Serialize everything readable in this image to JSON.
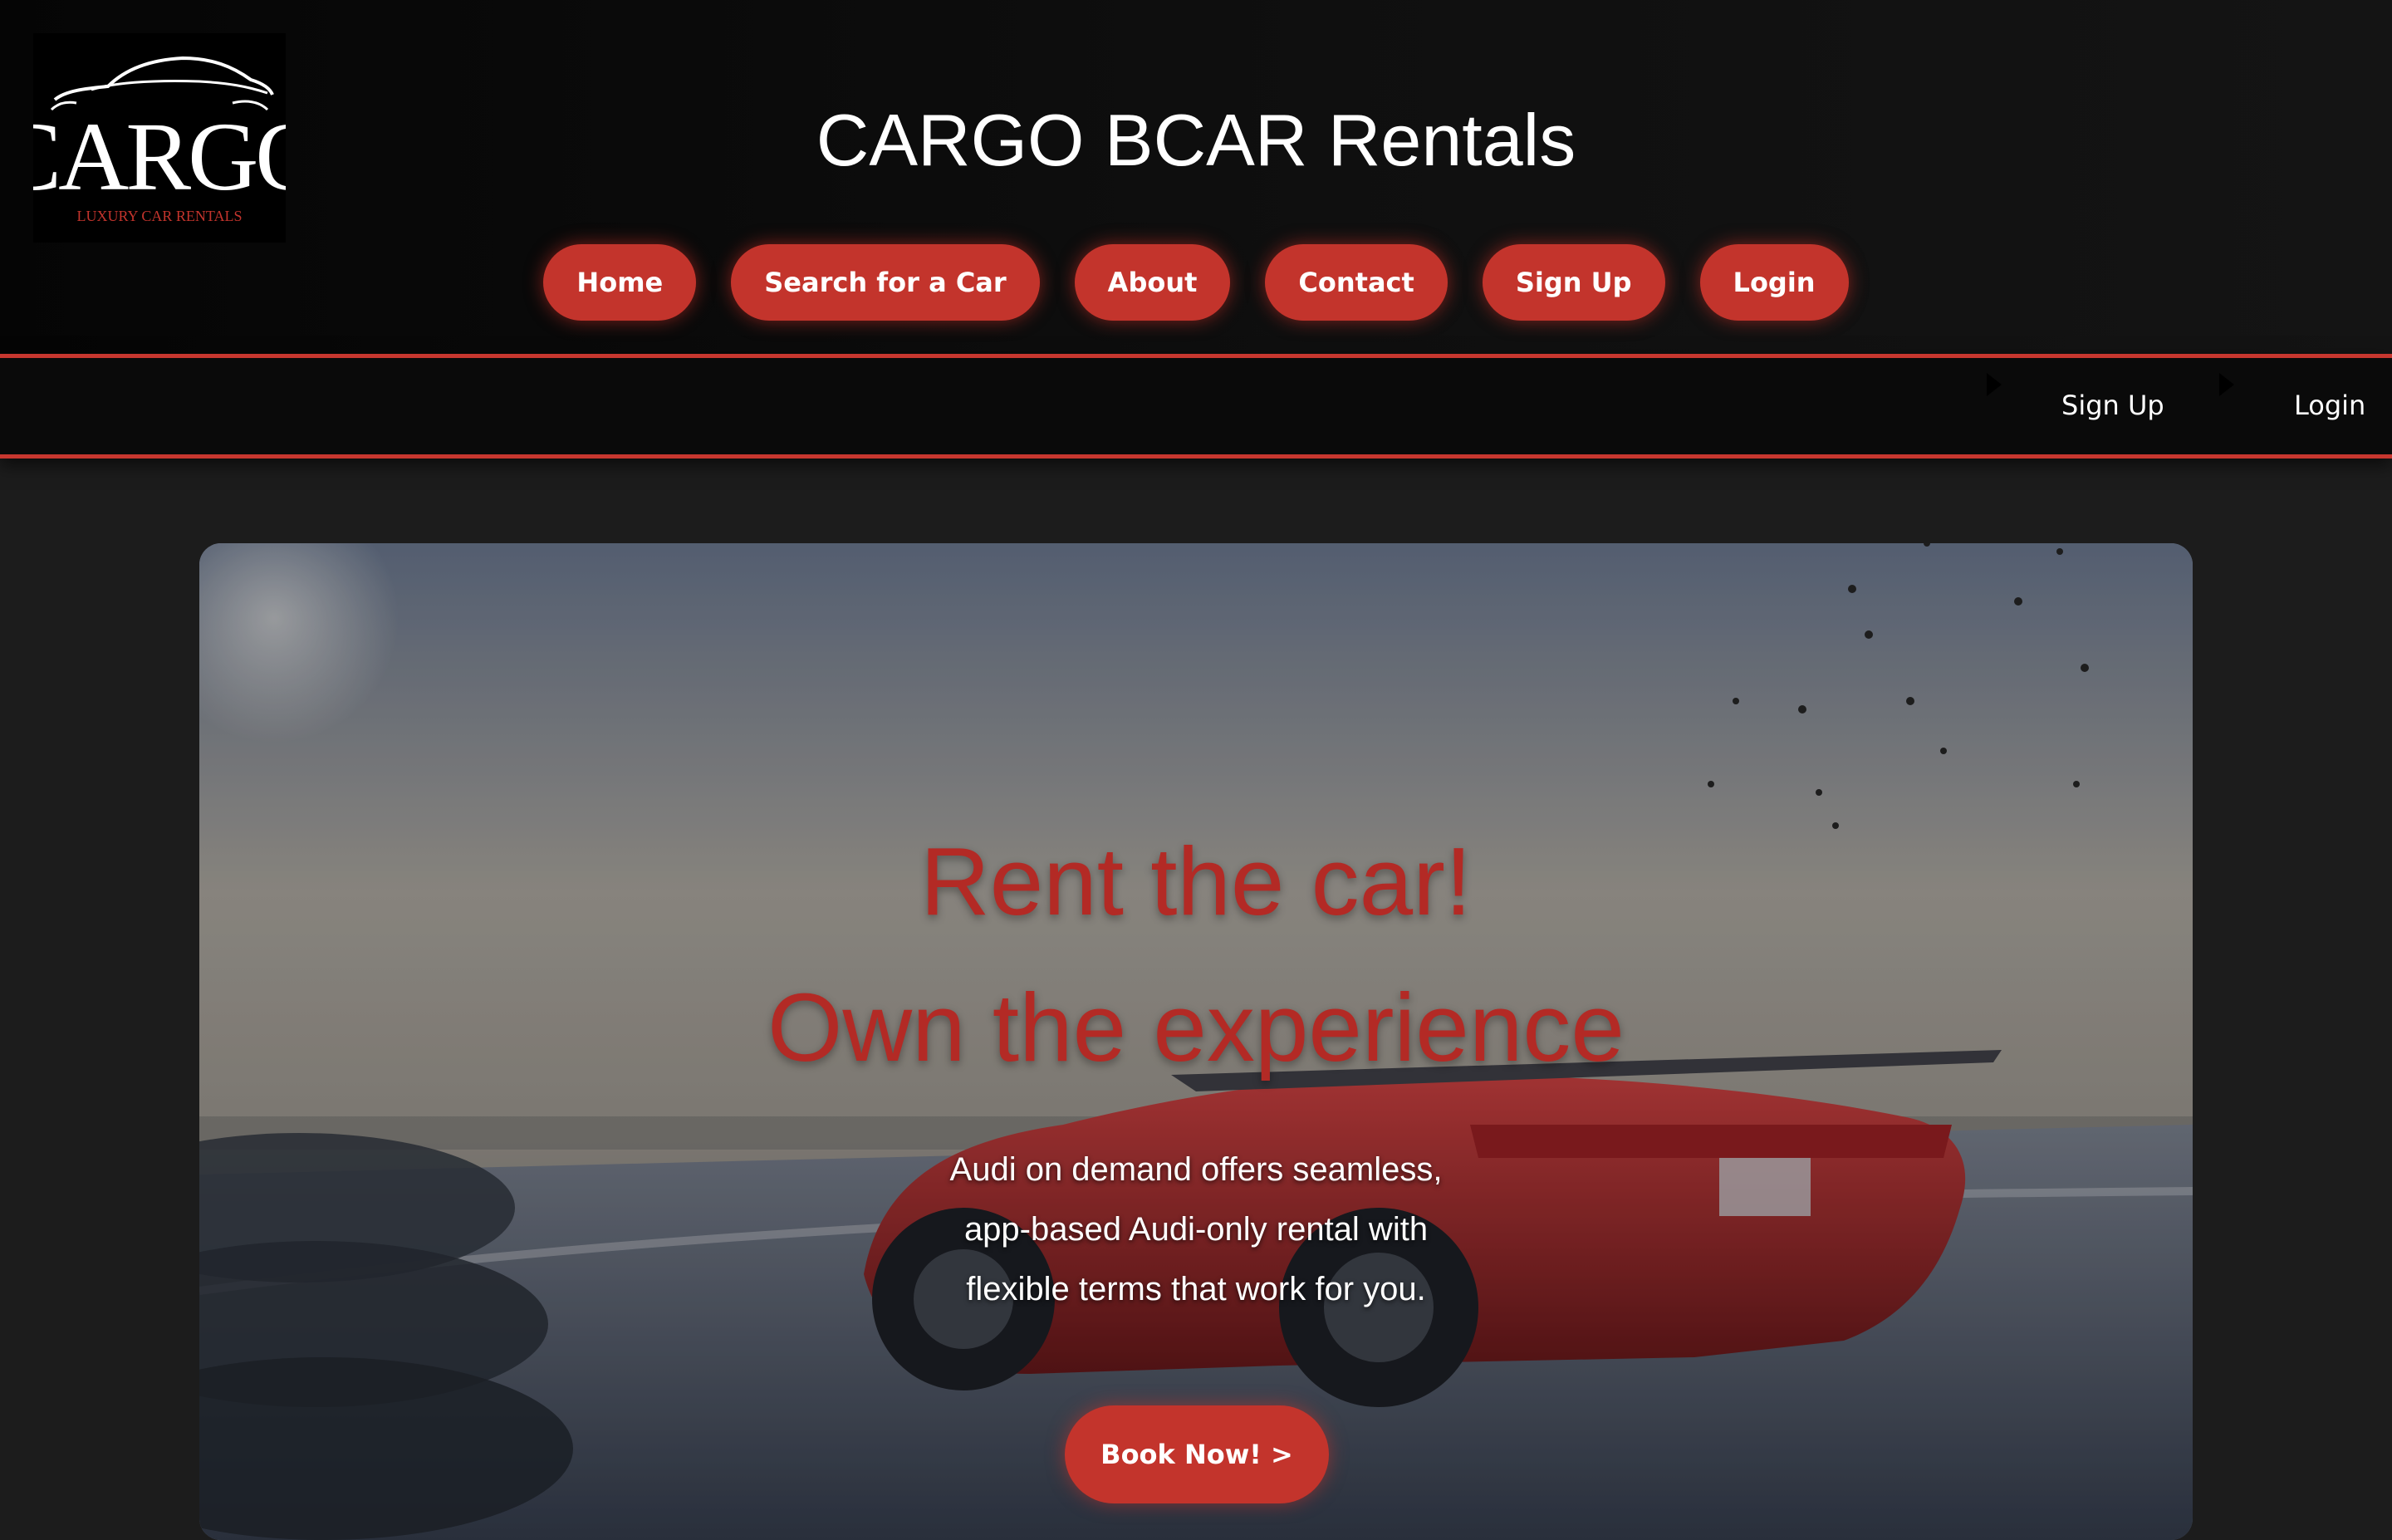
{
  "logo": {
    "wordmark": "CARGO",
    "tagline": "LUXURY CAR RENTALS"
  },
  "header": {
    "title": "CARGO BCAR Rentals"
  },
  "nav": {
    "items": [
      {
        "label": "Home"
      },
      {
        "label": "Search for a Car"
      },
      {
        "label": "About"
      },
      {
        "label": "Contact"
      },
      {
        "label": "Sign Up"
      },
      {
        "label": "Login"
      }
    ]
  },
  "sub_nav": {
    "items": [
      {
        "label": "Sign Up",
        "icon": "caret-right-icon"
      },
      {
        "label": "Login",
        "icon": "caret-right-icon"
      }
    ]
  },
  "hero": {
    "headline_1": "Rent the car!",
    "headline_2": "Own the experience",
    "description_lines": [
      "Audi on demand offers seamless,",
      "app-based Audi-only rental with",
      "flexible terms that work for you."
    ],
    "cta_label": "Book Now! >"
  },
  "colors": {
    "accent": "#c3342c",
    "header_bg": "#0a0a0a",
    "page_bg": "#1c1c1c",
    "headline": "#b32a25"
  }
}
